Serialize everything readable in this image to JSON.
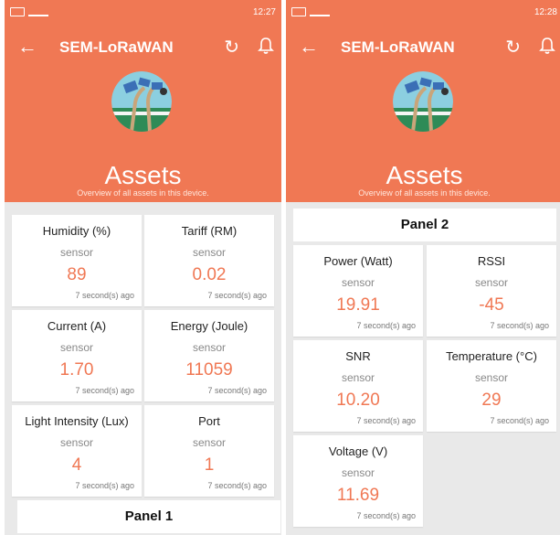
{
  "colors": {
    "accent": "#f07854",
    "background": "#e9e9e9",
    "card": "#ffffff"
  },
  "screens": [
    {
      "status": {
        "time": "12:27"
      },
      "appbar": {
        "title": "SEM-LoRaWAN",
        "back_icon": "arrow-left",
        "refresh_icon": "refresh",
        "bell_icon": "bell"
      },
      "hero": {
        "title": "Assets",
        "subtitle": "Overview of all assets in this device."
      },
      "cards": [
        {
          "label": "Humidity (%)",
          "type": "sensor",
          "value": "89",
          "ago": "7 second(s) ago"
        },
        {
          "label": "Tariff (RM)",
          "type": "sensor",
          "value": "0.02",
          "ago": "7 second(s) ago"
        },
        {
          "label": "Current (A)",
          "type": "sensor",
          "value": "1.70",
          "ago": "7 second(s) ago"
        },
        {
          "label": "Energy (Joule)",
          "type": "sensor",
          "value": "11059",
          "ago": "7 second(s) ago"
        },
        {
          "label": "Light Intensity (Lux)",
          "type": "sensor",
          "value": "4",
          "ago": "7 second(s) ago"
        },
        {
          "label": "Port",
          "type": "sensor",
          "value": "1",
          "ago": "7 second(s) ago"
        }
      ],
      "panel_title": "Panel 1"
    },
    {
      "status": {
        "time": "12:28"
      },
      "appbar": {
        "title": "SEM-LoRaWAN",
        "back_icon": "arrow-left",
        "refresh_icon": "refresh",
        "bell_icon": "bell"
      },
      "hero": {
        "title": "Assets",
        "subtitle": "Overview of all assets in this device."
      },
      "panel_title": "Panel 2",
      "cards": [
        {
          "label": "Power (Watt)",
          "type": "sensor",
          "value": "19.91",
          "ago": "7 second(s) ago"
        },
        {
          "label": "RSSI",
          "type": "sensor",
          "value": "-45",
          "ago": "7 second(s) ago"
        },
        {
          "label": "SNR",
          "type": "sensor",
          "value": "10.20",
          "ago": "7 second(s) ago"
        },
        {
          "label": "Temperature (°C)",
          "type": "sensor",
          "value": "29",
          "ago": "7 second(s) ago"
        },
        {
          "label": "Voltage (V)",
          "type": "sensor",
          "value": "11.69",
          "ago": "7 second(s) ago"
        }
      ]
    }
  ]
}
